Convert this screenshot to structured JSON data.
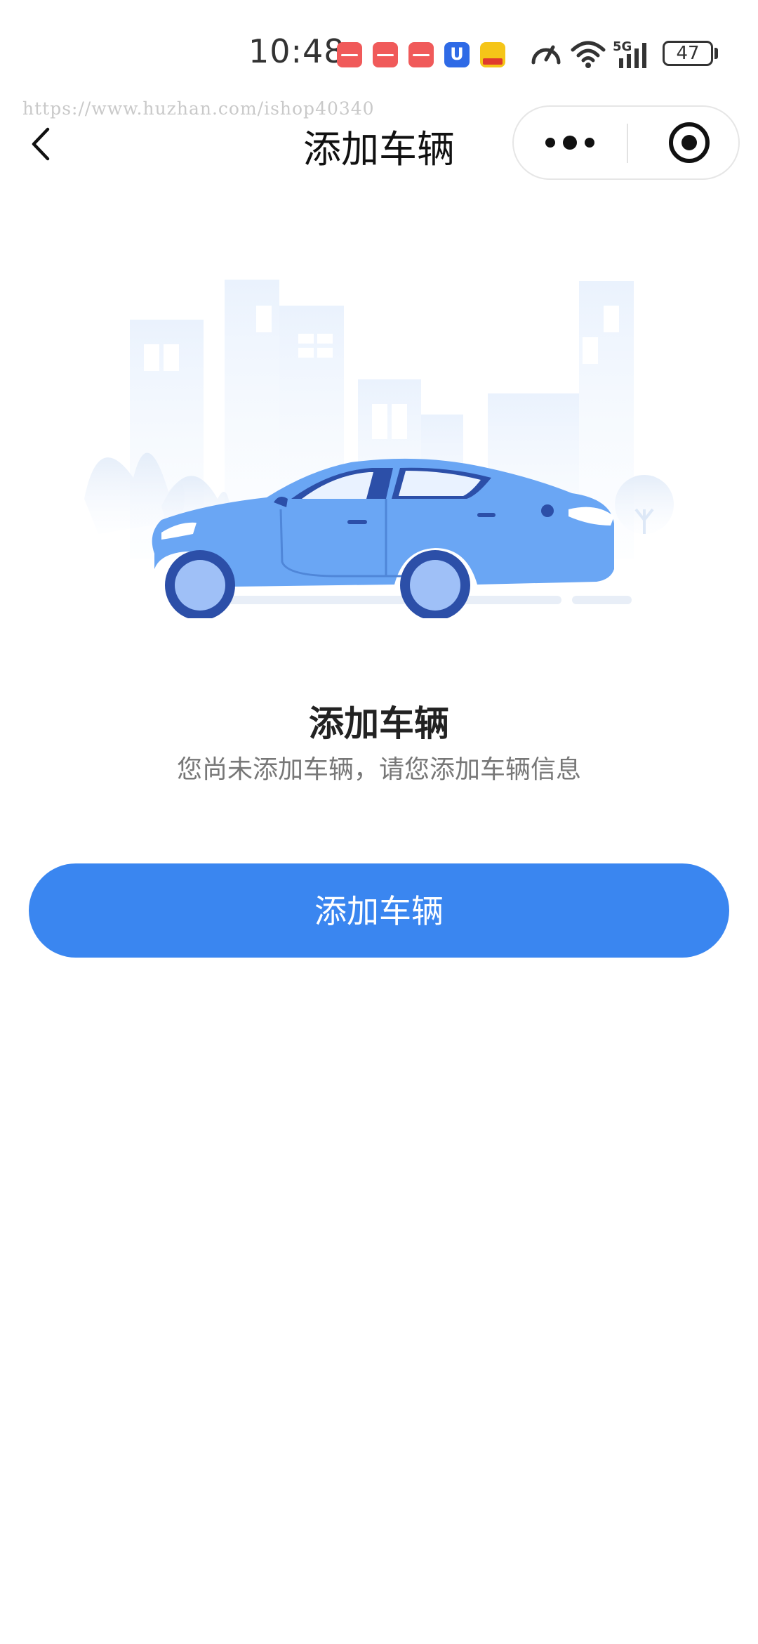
{
  "status_bar": {
    "time": "10:48",
    "battery": "47",
    "network": "5G"
  },
  "watermark": "https://www.huzhan.com/ishop40340",
  "nav": {
    "title": "添加车辆"
  },
  "empty_state": {
    "title": "添加车辆",
    "description": "您尚未添加车辆，请您添加车辆信息"
  },
  "actions": {
    "add_label": "添加车辆"
  },
  "colors": {
    "primary": "#3a86f0",
    "car_body": "#6aa6f4",
    "car_dark": "#2c4fa8",
    "background": "#ffffff"
  }
}
